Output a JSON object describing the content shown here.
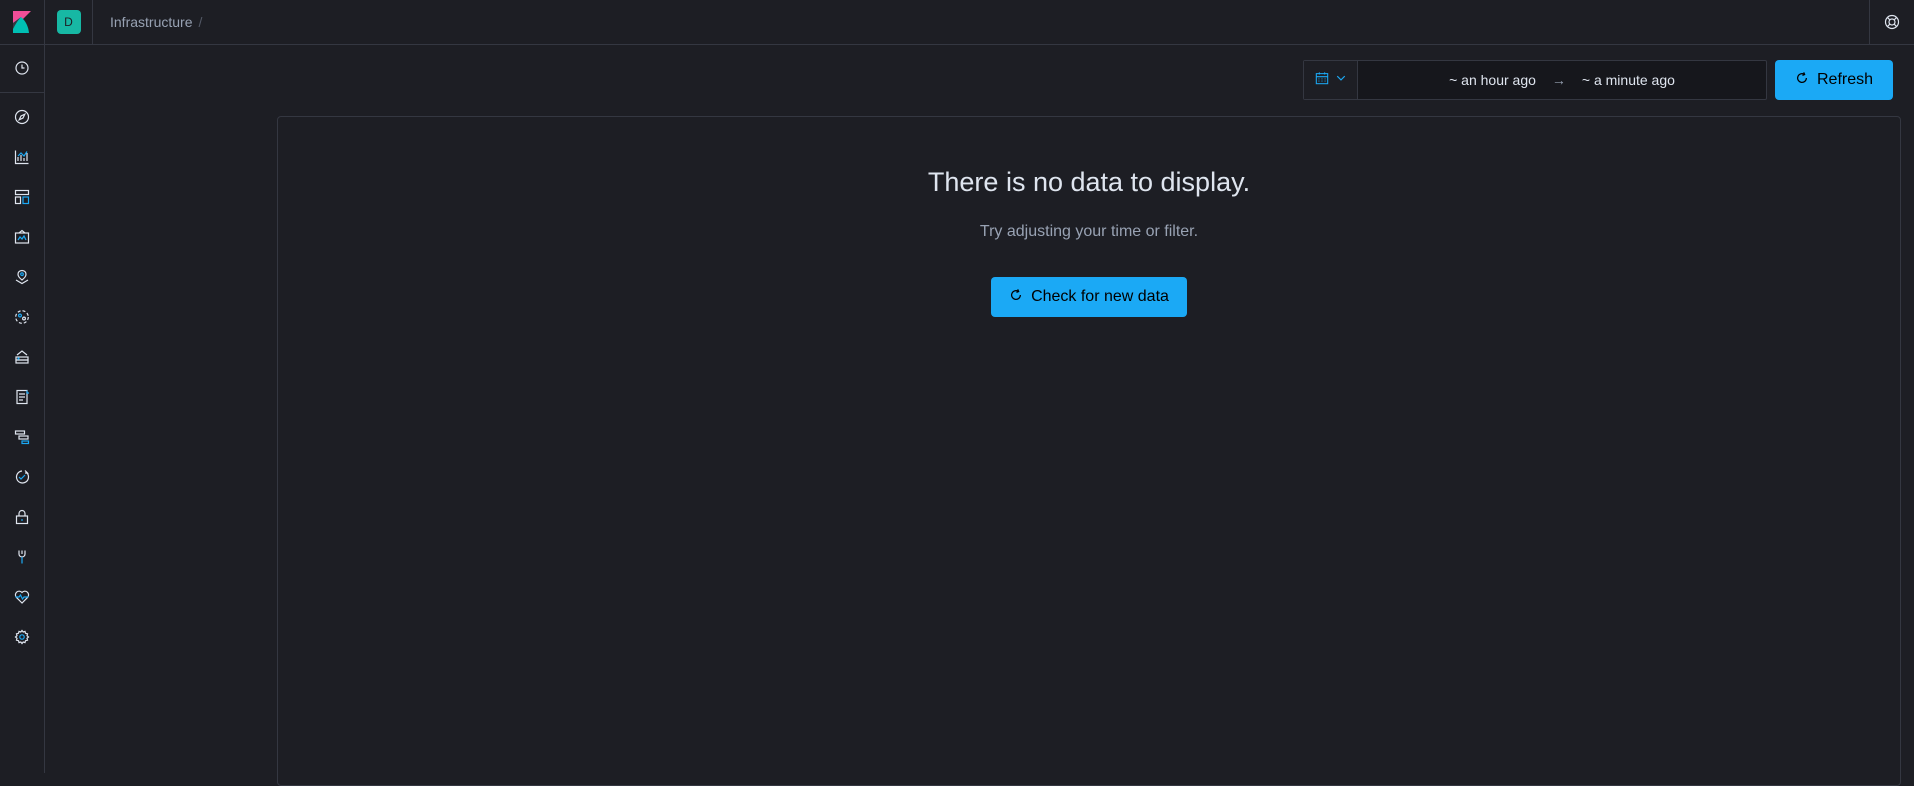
{
  "header": {
    "logo_icon": "kibana-logo-icon",
    "space_initial": "D",
    "space_color": "#17b8a4",
    "breadcrumb": "Infrastructure",
    "breadcrumb_sep": "/",
    "help_icon": "help-lifebuoy-icon"
  },
  "sidenav": {
    "items": [
      {
        "icon": "clock-icon",
        "name": "recently-viewed"
      },
      {
        "icon": "compass-icon",
        "name": "discover"
      },
      {
        "icon": "visualize-icon",
        "name": "visualize"
      },
      {
        "icon": "dashboard-icon",
        "name": "dashboard"
      },
      {
        "icon": "canvas-icon",
        "name": "canvas"
      },
      {
        "icon": "maps-icon",
        "name": "maps"
      },
      {
        "icon": "ml-icon",
        "name": "machine-learning"
      },
      {
        "icon": "infrastructure-icon",
        "name": "infrastructure"
      },
      {
        "icon": "logs-icon",
        "name": "logs"
      },
      {
        "icon": "apm-icon",
        "name": "apm"
      },
      {
        "icon": "uptime-icon",
        "name": "uptime"
      },
      {
        "icon": "siem-icon",
        "name": "siem"
      },
      {
        "icon": "devtools-icon",
        "name": "dev-tools"
      },
      {
        "icon": "monitoring-icon",
        "name": "stack-monitoring"
      },
      {
        "icon": "gear-icon",
        "name": "management"
      }
    ]
  },
  "toolbar": {
    "quick_menu_icon": "calendar-icon",
    "start": "~ an hour ago",
    "arrow": "→",
    "end": "~ a minute ago",
    "refresh_label": "Refresh",
    "refresh_icon": "refresh-icon"
  },
  "empty_state": {
    "title": "There is no data to display.",
    "subtitle": "Try adjusting your time or filter.",
    "button_label": "Check for new data",
    "button_icon": "refresh-icon"
  },
  "colors": {
    "accent": "#1ba9f5",
    "background": "#1d1e24",
    "border": "#343741",
    "icon": "#98a2b3",
    "logo_pink": "#f04e98",
    "logo_teal": "#00bfb3"
  }
}
